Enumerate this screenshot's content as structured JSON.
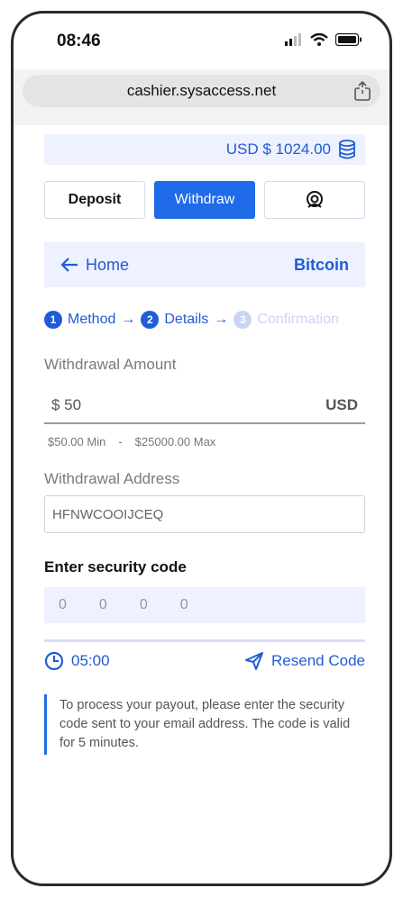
{
  "status_bar": {
    "time": "08:46",
    "icons": [
      "signal-icon",
      "wifi-icon",
      "battery-icon"
    ]
  },
  "browser": {
    "url": "cashier.sysaccess.net",
    "share_icon": "share-icon"
  },
  "balance": {
    "text": "USD $ 1024.00",
    "icon": "coins-stack-icon"
  },
  "tabs": [
    {
      "label": "Deposit",
      "active": false
    },
    {
      "label": "Withdraw",
      "active": true
    },
    {
      "label": "",
      "icon": "support-icon",
      "active": false
    }
  ],
  "nav": {
    "back_label": "Home",
    "method": "Bitcoin"
  },
  "steps": [
    {
      "num": "1",
      "label": "Method",
      "active": true
    },
    {
      "num": "2",
      "label": "Details",
      "active": true
    },
    {
      "num": "3",
      "label": "Confirmation",
      "active": false
    }
  ],
  "withdrawal": {
    "amount_label": "Withdrawal Amount",
    "amount_value": "$ 50",
    "currency": "USD",
    "min": "$50.00 Min",
    "separator": "-",
    "max": "$25000.00 Max",
    "address_label": "Withdrawal Address",
    "address_value": "HFNWCOOIJCEQ"
  },
  "security": {
    "label": "Enter security code",
    "digits": [
      "0",
      "0",
      "0",
      "0"
    ],
    "timer": "05:00",
    "resend_label": "Resend Code",
    "note": "To process your payout, please enter the security code sent to your email address. The code is valid for 5 minutes."
  },
  "colors": {
    "accent": "#1f6be8",
    "light_bg": "#eef1ff"
  }
}
